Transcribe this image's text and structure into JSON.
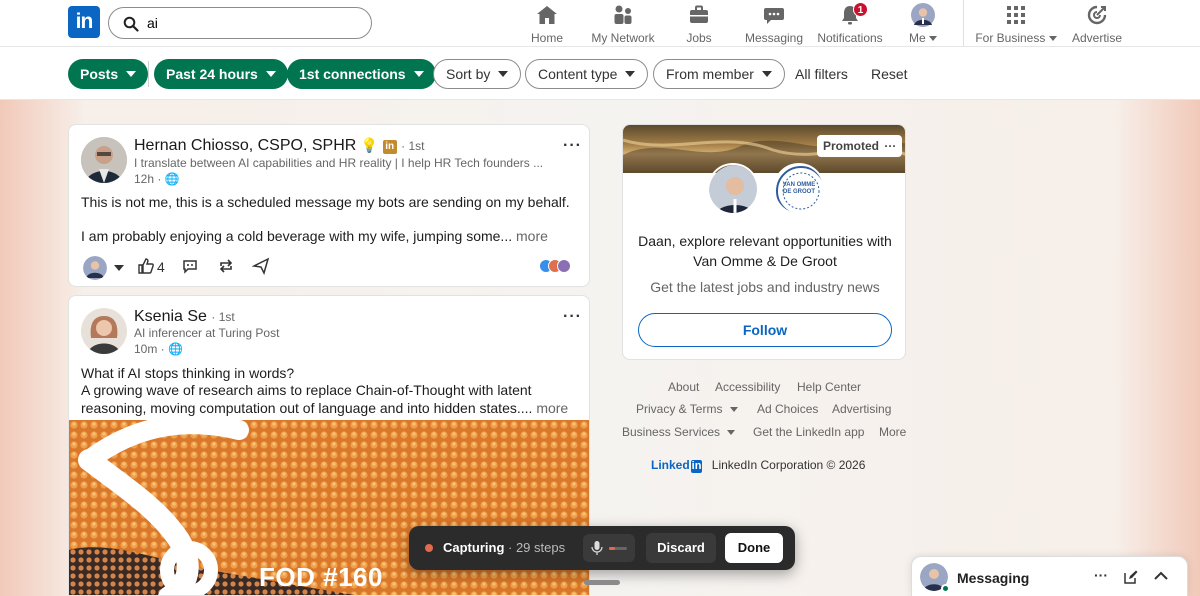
{
  "brand": {
    "logo_text": "in",
    "accent": "#0a66c2",
    "green": "#01754f"
  },
  "search": {
    "value": "ai",
    "icon": "search-icon"
  },
  "nav": {
    "home": "Home",
    "network": "My Network",
    "jobs": "Jobs",
    "messaging": "Messaging",
    "notifications": "Notifications",
    "notifications_count": "1",
    "me": "Me",
    "business": "For Business",
    "advertise": "Advertise"
  },
  "filters": {
    "posts": "Posts",
    "past24": "Past 24 hours",
    "connections": "1st connections",
    "sort": "Sort by",
    "content_type": "Content type",
    "from_member": "From member",
    "all_filters": "All filters",
    "reset": "Reset"
  },
  "posts": [
    {
      "author": "Hernan Chiosso, CSPO, SPHR",
      "degree": "1st",
      "headline": "I translate between AI capabilities and HR reality | I help HR Tech founders ...",
      "time": "12h",
      "text1": "This is not me, this is a scheduled message my bots are sending on my behalf.",
      "text2": "I am probably enjoying a cold beverage with my wife, jumping some...",
      "more": "more",
      "likes": "4"
    },
    {
      "author": "Ksenia Se",
      "degree": "1st",
      "headline": "AI inferencer at Turing Post",
      "time": "10m",
      "text1": "What if AI stops thinking in words?",
      "text2": "A growing wave of research aims to replace Chain-of-Thought with latent reasoning, moving computation out of language and into hidden states....",
      "more": "more",
      "image_caption": "FOD #160"
    }
  ],
  "ad": {
    "promoted": "Promoted",
    "headline": "Daan, explore relevant opportunities with Van Omme & De Groot",
    "sub": "Get the latest jobs and industry news",
    "follow": "Follow",
    "logo_text_1": "VAN OMME",
    "logo_text_2": "DE GROOT"
  },
  "footer": {
    "about": "About",
    "accessibility": "Accessibility",
    "help": "Help Center",
    "privacy": "Privacy & Terms",
    "adchoices": "Ad Choices",
    "advertising": "Advertising",
    "business": "Business Services",
    "app": "Get the LinkedIn app",
    "more": "More",
    "brand": "Linked",
    "copyright": "LinkedIn Corporation © 2026"
  },
  "capture": {
    "label": "Capturing",
    "steps": "· 29 steps",
    "discard": "Discard",
    "done": "Done"
  },
  "messaging": {
    "label": "Messaging"
  }
}
